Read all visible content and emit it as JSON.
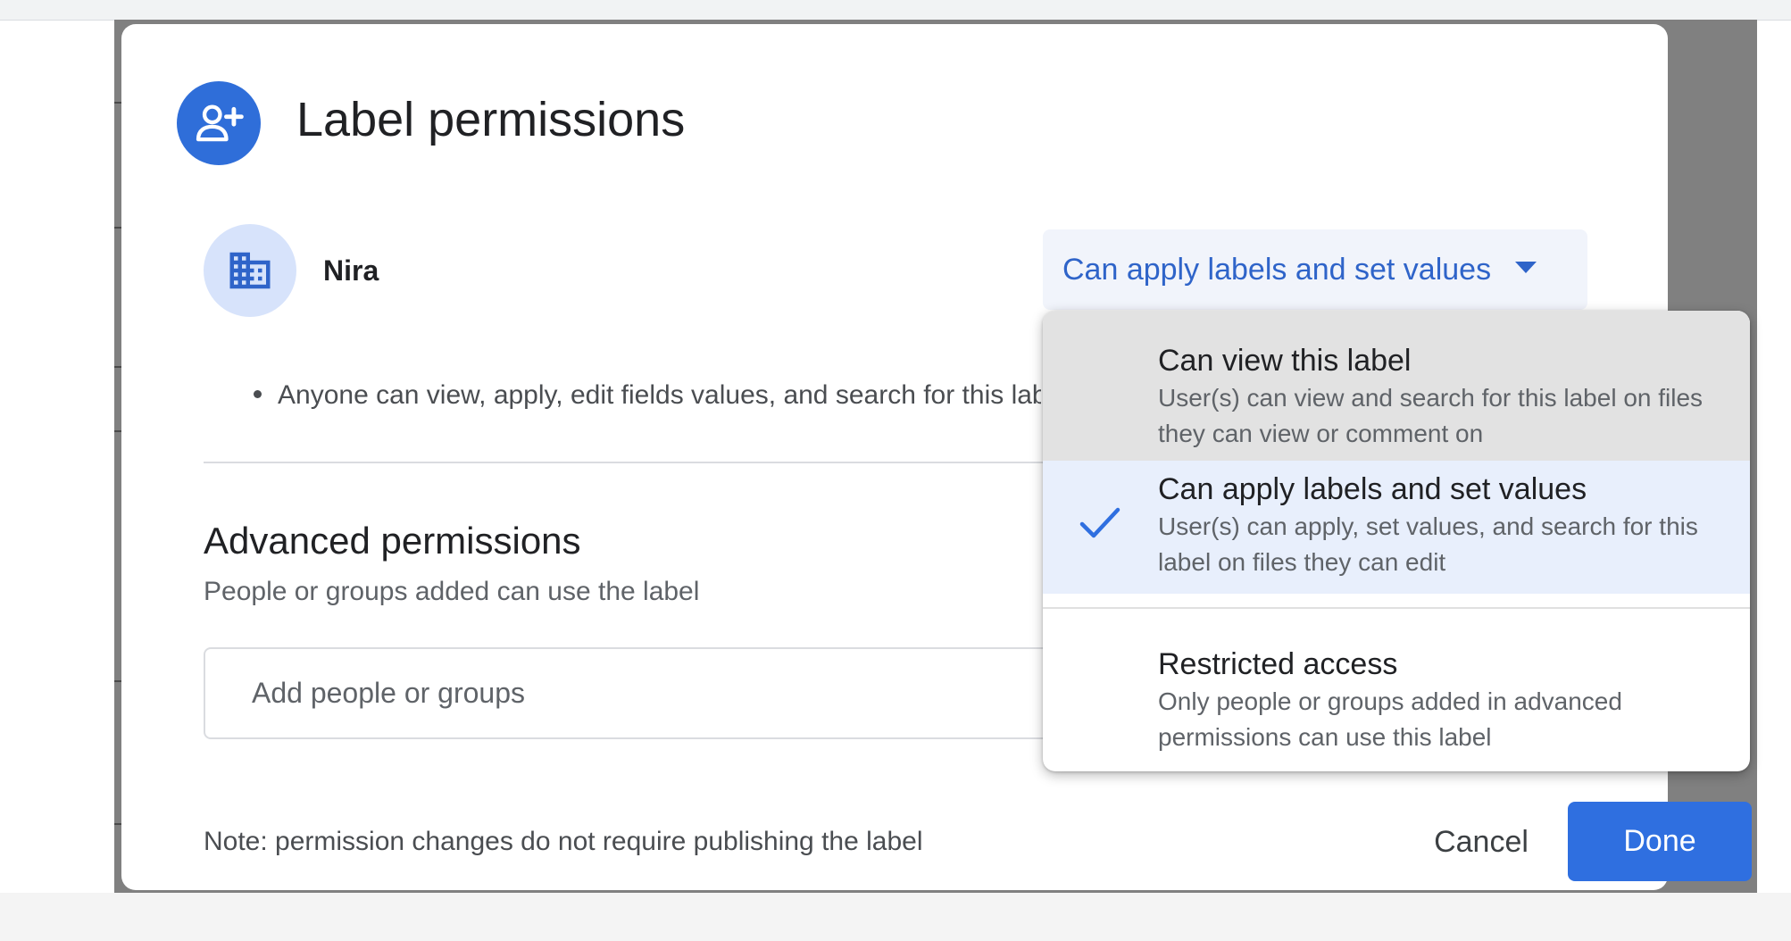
{
  "dialog": {
    "title": "Label permissions",
    "entity": {
      "name": "Nira",
      "role_selected": "Can apply labels and set values",
      "summary": "Anyone can view, apply, edit fields values, and search for this label"
    },
    "advanced": {
      "heading": "Advanced permissions",
      "subtitle": "People or groups added can use the label",
      "input_placeholder": "Add people or groups"
    },
    "note": "Note: permission changes do not require publishing the label",
    "buttons": {
      "cancel": "Cancel",
      "done": "Done"
    }
  },
  "role_menu": {
    "items": [
      {
        "title": "Can view this label",
        "description": "User(s) can view and search for this label on files they can view or comment on",
        "selected": false,
        "hovered": true
      },
      {
        "title": "Can apply labels and set values",
        "description": "User(s) can apply, set values, and search for this label on files they can edit",
        "selected": true
      },
      {
        "title": "Restricted access",
        "description": "Only people or groups added in advanced permissions can use this label",
        "selected": false
      }
    ]
  },
  "icons": {
    "header": "person-add-icon",
    "entity": "domain-building-icon",
    "dropdown": "arrow-drop-down-icon",
    "selected": "check-icon"
  },
  "colors": {
    "accent": "#2f6fe0",
    "accent_text": "#2f64c9",
    "selected_bg": "#e8effc",
    "hover_bg": "#e2e2e2",
    "avatar_bg": "#d7e3fb"
  }
}
